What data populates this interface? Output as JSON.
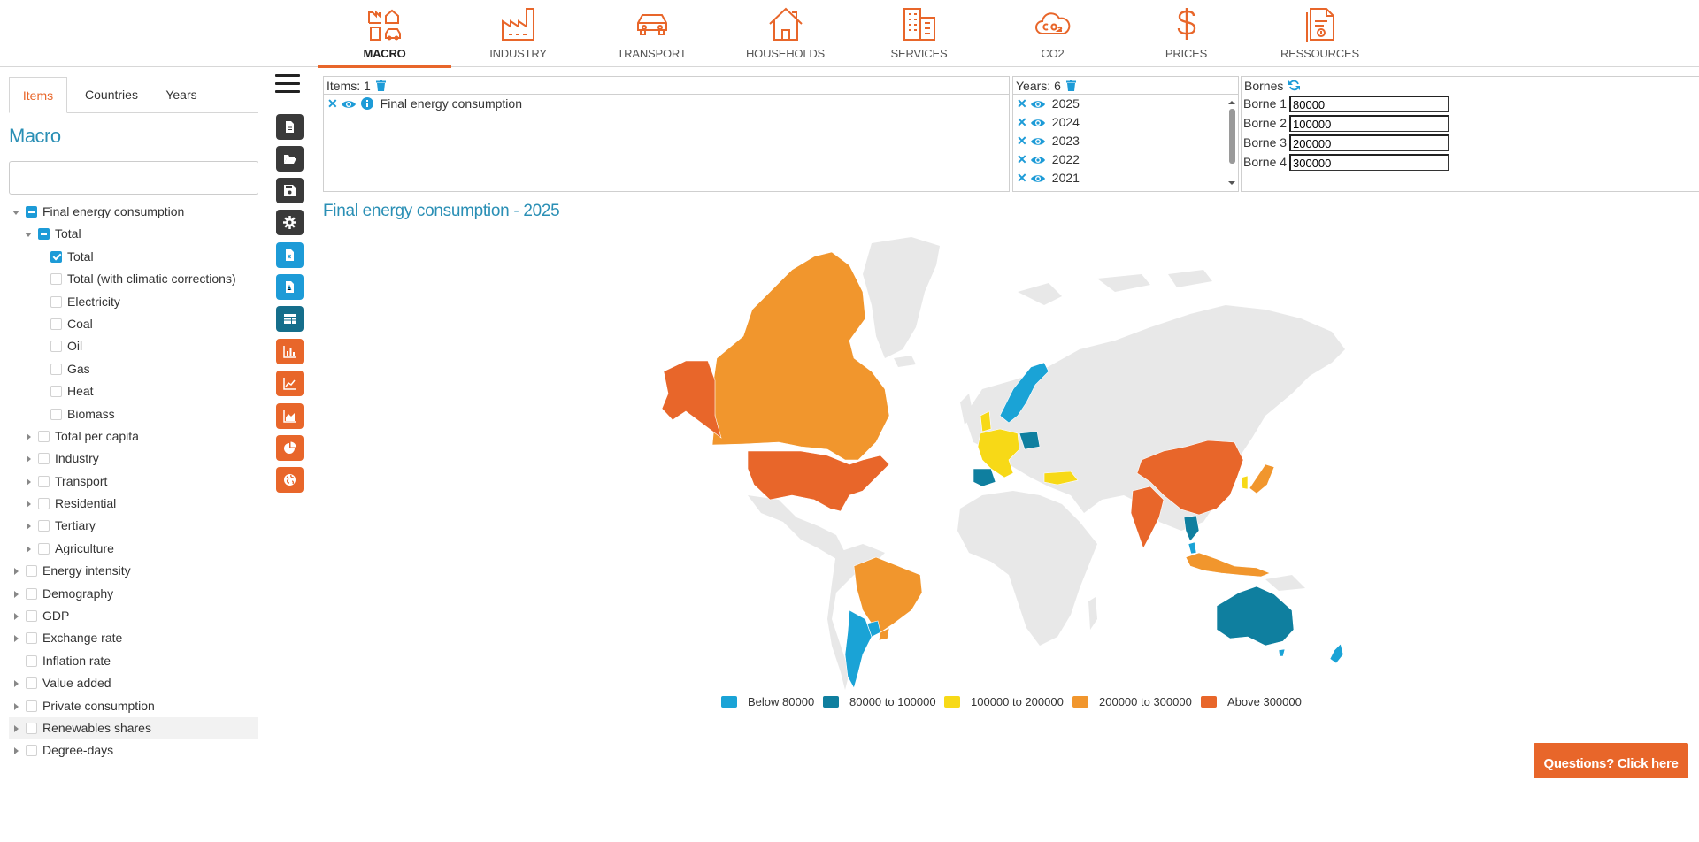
{
  "nav": {
    "items": [
      {
        "label": "MACRO",
        "icon": "macro-icon"
      },
      {
        "label": "INDUSTRY",
        "icon": "factory-icon"
      },
      {
        "label": "TRANSPORT",
        "icon": "car-icon"
      },
      {
        "label": "HOUSEHOLDS",
        "icon": "house-icon"
      },
      {
        "label": "SERVICES",
        "icon": "building-icon"
      },
      {
        "label": "CO2",
        "icon": "co2-cloud-icon"
      },
      {
        "label": "PRICES",
        "icon": "dollar-icon"
      },
      {
        "label": "RESSOURCES",
        "icon": "document-icon"
      }
    ],
    "active": "MACRO",
    "accent": "#e8662a"
  },
  "left": {
    "tabs": [
      "Items",
      "Countries",
      "Years"
    ],
    "active_tab": "Items",
    "title": "Macro",
    "search_value": "",
    "tree": [
      {
        "label": "Final energy consumption",
        "state": "partial",
        "expanded": true
      },
      {
        "label": "Total",
        "state": "partial",
        "expanded": true
      },
      {
        "label": "Total",
        "state": "checked"
      },
      {
        "label": "Total (with climatic corrections)",
        "state": "unchecked"
      },
      {
        "label": "Electricity",
        "state": "unchecked"
      },
      {
        "label": "Coal",
        "state": "unchecked"
      },
      {
        "label": "Oil",
        "state": "unchecked"
      },
      {
        "label": "Gas",
        "state": "unchecked"
      },
      {
        "label": "Heat",
        "state": "unchecked"
      },
      {
        "label": "Biomass",
        "state": "unchecked"
      },
      {
        "label": "Total per capita",
        "state": "unchecked"
      },
      {
        "label": "Industry",
        "state": "unchecked"
      },
      {
        "label": "Transport",
        "state": "unchecked"
      },
      {
        "label": "Residential",
        "state": "unchecked"
      },
      {
        "label": "Tertiary",
        "state": "unchecked"
      },
      {
        "label": "Agriculture",
        "state": "unchecked"
      },
      {
        "label": "Energy intensity",
        "state": "unchecked"
      },
      {
        "label": "Demography",
        "state": "unchecked"
      },
      {
        "label": "GDP",
        "state": "unchecked"
      },
      {
        "label": "Exchange rate",
        "state": "unchecked"
      },
      {
        "label": "Inflation rate",
        "state": "unchecked"
      },
      {
        "label": "Value added",
        "state": "unchecked"
      },
      {
        "label": "Private consumption",
        "state": "unchecked"
      },
      {
        "label": "Renewables shares",
        "state": "unchecked"
      },
      {
        "label": "Degree-days",
        "state": "unchecked"
      }
    ]
  },
  "tools": [
    {
      "name": "hamburger-menu-icon"
    },
    {
      "name": "new-file-icon"
    },
    {
      "name": "open-folder-icon"
    },
    {
      "name": "save-icon"
    },
    {
      "name": "settings-icon"
    },
    {
      "name": "excel-export-icon"
    },
    {
      "name": "pdf-export-icon"
    },
    {
      "name": "table-view-icon"
    },
    {
      "name": "bar-chart-icon"
    },
    {
      "name": "line-chart-icon"
    },
    {
      "name": "area-chart-icon"
    },
    {
      "name": "pie-chart-icon"
    },
    {
      "name": "globe-map-icon"
    }
  ],
  "items_box": {
    "header": "Items: 1",
    "items": [
      "Final energy consumption"
    ]
  },
  "years_box": {
    "header": "Years: 6",
    "years": [
      "2025",
      "2024",
      "2023",
      "2022",
      "2021"
    ]
  },
  "bornes_box": {
    "header": "Bornes",
    "rows": [
      {
        "label": "Borne 1",
        "value": "80000"
      },
      {
        "label": "Borne 2",
        "value": "100000"
      },
      {
        "label": "Borne 3",
        "value": "200000"
      },
      {
        "label": "Borne 4",
        "value": "300000"
      }
    ]
  },
  "map": {
    "title": "Final energy consumption - 2025",
    "land_color": "#e8e8e8",
    "legend": [
      {
        "label": "Below 80000",
        "color": "#1aa3d6"
      },
      {
        "label": "80000 to 100000",
        "color": "#0f7f9f"
      },
      {
        "label": "100000 to 200000",
        "color": "#f7d917"
      },
      {
        "label": "200000 to 300000",
        "color": "#f1962d"
      },
      {
        "label": "Above 300000",
        "color": "#e8662a"
      }
    ],
    "regions": [
      {
        "name": "Canada",
        "class": "200000 to 300000"
      },
      {
        "name": "Alaska",
        "class": "Above 300000"
      },
      {
        "name": "United States",
        "class": "Above 300000"
      },
      {
        "name": "Brazil",
        "class": "200000 to 300000"
      },
      {
        "name": "Argentina",
        "class": "Below 80000"
      },
      {
        "name": "Paraguay",
        "class": "Below 80000"
      },
      {
        "name": "Norway/Sweden",
        "class": "Below 80000"
      },
      {
        "name": "Poland",
        "class": "80000 to 100000"
      },
      {
        "name": "Western Europe",
        "class": "100000 to 200000"
      },
      {
        "name": "Spain/Portugal",
        "class": "80000 to 100000"
      },
      {
        "name": "Turkey",
        "class": "100000 to 200000"
      },
      {
        "name": "China",
        "class": "Above 300000"
      },
      {
        "name": "India",
        "class": "Above 300000"
      },
      {
        "name": "Japan",
        "class": "200000 to 300000"
      },
      {
        "name": "Korea",
        "class": "100000 to 200000"
      },
      {
        "name": "Thailand",
        "class": "80000 to 100000"
      },
      {
        "name": "Malaysia",
        "class": "Below 80000"
      },
      {
        "name": "Indonesia",
        "class": "200000 to 300000"
      },
      {
        "name": "Australia",
        "class": "80000 to 100000"
      },
      {
        "name": "New Zealand",
        "class": "Below 80000"
      }
    ]
  },
  "questions_label": "Questions? Click here"
}
